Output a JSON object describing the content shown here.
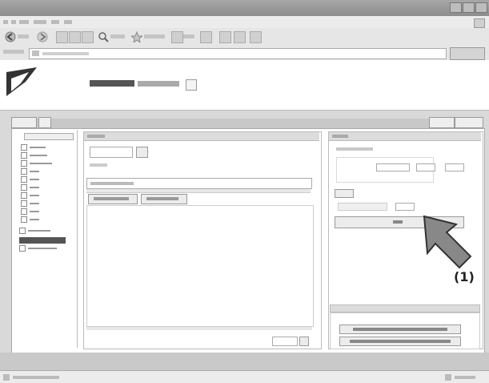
{
  "callout": {
    "label": "(1)"
  }
}
